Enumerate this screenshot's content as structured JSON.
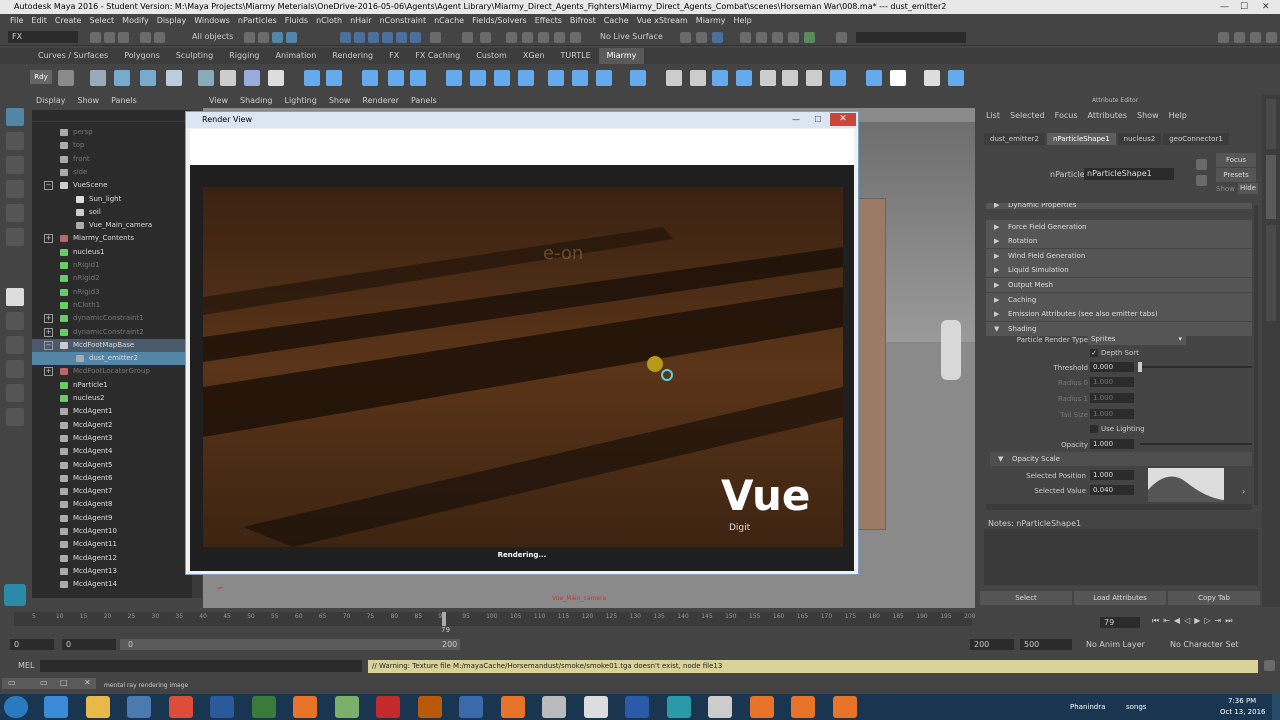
{
  "window": {
    "title": "Autodesk Maya 2016 - Student Version: M:\\Maya Projects\\Miarmy Meterials\\OneDrive-2016-05-06\\Agents\\Agent Library\\Miarmy_Direct_Agents_Fighters\\Miarmy_Direct_Agents_Combat\\scenes\\Horseman War\\008.ma*   ---   dust_emitter2"
  },
  "menubar": [
    "File",
    "Edit",
    "Create",
    "Select",
    "Modify",
    "Display",
    "Windows",
    "nParticles",
    "Fluids",
    "nCloth",
    "nHair",
    "nConstraint",
    "nCache",
    "Fields/Solvers",
    "Effects",
    "Bifrost",
    "Cache",
    "Vue xStream",
    "Miarmy",
    "Help"
  ],
  "statusline": {
    "mode": "FX",
    "selection_mask": "All objects",
    "live_surface": "No Live Surface"
  },
  "shelf_tabs": [
    "Curves / Surfaces",
    "Polygons",
    "Sculpting",
    "Rigging",
    "Animation",
    "Rendering",
    "FX",
    "FX Caching",
    "Custom",
    "XGen",
    "TURTLE",
    "Miarmy"
  ],
  "shelf_active": "Miarmy",
  "outliner": {
    "menu": [
      "Display",
      "Show",
      "Panels"
    ],
    "items": [
      {
        "label": "persp",
        "dim": true,
        "indent": 1,
        "icon": "camera-icon"
      },
      {
        "label": "top",
        "dim": true,
        "indent": 1,
        "icon": "camera-icon"
      },
      {
        "label": "front",
        "dim": true,
        "indent": 1,
        "icon": "camera-icon"
      },
      {
        "label": "side",
        "dim": true,
        "indent": 1,
        "icon": "camera-icon"
      },
      {
        "label": "VueScene",
        "dim": false,
        "indent": 1,
        "icon": "group-icon",
        "expander": "−"
      },
      {
        "label": "Sun_light",
        "dim": false,
        "indent": 2,
        "icon": "light-icon"
      },
      {
        "label": "soil",
        "dim": false,
        "indent": 2,
        "icon": "transform-icon"
      },
      {
        "label": "Vue_Main_camera",
        "dim": false,
        "indent": 2,
        "icon": "camera-icon"
      },
      {
        "label": "Miarmy_Contents",
        "dim": false,
        "indent": 1,
        "icon": "miarmy-icon",
        "expander": "+"
      },
      {
        "label": "nucleus1",
        "dim": false,
        "indent": 1,
        "icon": "nucleus-icon"
      },
      {
        "label": "nRigid1",
        "dim": true,
        "indent": 1,
        "icon": "nrigid-icon"
      },
      {
        "label": "nRigid2",
        "dim": true,
        "indent": 1,
        "icon": "nrigid-icon"
      },
      {
        "label": "nRigid3",
        "dim": true,
        "indent": 1,
        "icon": "nrigid-icon"
      },
      {
        "label": "nCloth1",
        "dim": true,
        "indent": 1,
        "icon": "ncloth-icon"
      },
      {
        "label": "dynamicConstraint1",
        "dim": true,
        "indent": 1,
        "icon": "constraint-icon",
        "expander": "+"
      },
      {
        "label": "dynamicConstraint2",
        "dim": true,
        "indent": 1,
        "icon": "constraint-icon",
        "expander": "+"
      },
      {
        "label": "McdFootMapBase",
        "dim": false,
        "indent": 1,
        "icon": "group-icon",
        "expander": "−",
        "highlight": true
      },
      {
        "label": "dust_emitter2",
        "dim": false,
        "indent": 2,
        "icon": "emitter-icon",
        "selected": true
      },
      {
        "label": "McdFootLocatorGroup",
        "dim": true,
        "indent": 1,
        "icon": "miarmy-icon",
        "expander": "+"
      },
      {
        "label": "nParticle1",
        "dim": false,
        "indent": 1,
        "icon": "nparticle-icon"
      },
      {
        "label": "nucleus2",
        "dim": false,
        "indent": 1,
        "icon": "nucleus-icon"
      },
      {
        "label": "McdAgent1",
        "dim": false,
        "indent": 1,
        "icon": "agent-icon"
      },
      {
        "label": "McdAgent2",
        "dim": false,
        "indent": 1,
        "icon": "agent-icon"
      },
      {
        "label": "McdAgent3",
        "dim": false,
        "indent": 1,
        "icon": "agent-icon"
      },
      {
        "label": "McdAgent4",
        "dim": false,
        "indent": 1,
        "icon": "agent-icon"
      },
      {
        "label": "McdAgent5",
        "dim": false,
        "indent": 1,
        "icon": "agent-icon"
      },
      {
        "label": "McdAgent6",
        "dim": false,
        "indent": 1,
        "icon": "agent-icon"
      },
      {
        "label": "McdAgent7",
        "dim": false,
        "indent": 1,
        "icon": "agent-icon"
      },
      {
        "label": "McdAgent8",
        "dim": false,
        "indent": 1,
        "icon": "agent-icon"
      },
      {
        "label": "McdAgent9",
        "dim": false,
        "indent": 1,
        "icon": "agent-icon"
      },
      {
        "label": "McdAgent10",
        "dim": false,
        "indent": 1,
        "icon": "agent-icon"
      },
      {
        "label": "McdAgent11",
        "dim": false,
        "indent": 1,
        "icon": "agent-icon"
      },
      {
        "label": "McdAgent12",
        "dim": false,
        "indent": 1,
        "icon": "agent-icon"
      },
      {
        "label": "McdAgent13",
        "dim": false,
        "indent": 1,
        "icon": "agent-icon"
      },
      {
        "label": "McdAgent14",
        "dim": false,
        "indent": 1,
        "icon": "agent-icon"
      }
    ]
  },
  "viewport": {
    "menu": [
      "View",
      "Shading",
      "Lighting",
      "Show",
      "Renderer",
      "Panels"
    ],
    "camera_label": "Vue_Main_camera"
  },
  "render_view": {
    "title": "Render View",
    "status": "Rendering...",
    "watermark_logo": "e-on",
    "brand_logo": "Vue",
    "brand_sub": "Digit"
  },
  "attribute_editor": {
    "header": "Attribute Editor",
    "menu": [
      "List",
      "Selected",
      "Focus",
      "Attributes",
      "Show",
      "Help"
    ],
    "tabs": [
      "dust_emitter2",
      "nParticleShape1",
      "nucleus2",
      "geoConnector1"
    ],
    "active_tab": "nParticleShape1",
    "node_label": "nParticle:",
    "node_value": "nParticleShape1",
    "focus_btn": "Focus",
    "presets_btn": "Presets",
    "show_label": "Show",
    "hide_btn": "Hide",
    "sections": [
      "Dynamic Properties",
      "Force Field Generation",
      "Rotation",
      "Wind Field Generation",
      "Liquid Simulation",
      "Output Mesh",
      "Caching",
      "Emission Attributes (see also emitter tabs)",
      "Shading"
    ],
    "shading": {
      "render_type_label": "Particle Render Type",
      "render_type_value": "Sprites",
      "depth_sort_label": "Depth Sort",
      "depth_sort": true,
      "threshold_label": "Threshold",
      "threshold_value": "0.000",
      "radius0_label": "Radius 0",
      "radius0_value": "1.000",
      "radius1_label": "Radius 1",
      "radius1_value": "1.000",
      "tailsize_label": "Tail Size",
      "tailsize_value": "1.000",
      "use_lighting_label": "Use Lighting",
      "opacity_label": "Opacity",
      "opacity_value": "1.000"
    },
    "opacity_scale": {
      "title": "Opacity Scale",
      "sel_pos_label": "Selected Position",
      "sel_pos_value": "1.000",
      "sel_val_label": "Selected Value",
      "sel_val_value": "0.040"
    },
    "notes_label": "Notes:  nParticleShape1",
    "bottom_buttons": [
      "Select",
      "Load Attributes",
      "Copy Tab"
    ],
    "side_tabs": [
      "Tool Settings",
      "Attribute Editor",
      "Channel Box / Layer Editor"
    ]
  },
  "timeline": {
    "ticks": [
      "5",
      "10",
      "15",
      "20",
      "25",
      "30",
      "35",
      "40",
      "45",
      "50",
      "55",
      "60",
      "65",
      "70",
      "75",
      "80",
      "85",
      "90",
      "95",
      "100",
      "105",
      "110",
      "115",
      "120",
      "125",
      "130",
      "135",
      "140",
      "145",
      "150",
      "155",
      "160",
      "165",
      "170",
      "175",
      "180",
      "185",
      "190",
      "195",
      "200"
    ],
    "current_frame": "79",
    "current_field": "79"
  },
  "range": {
    "start": "0",
    "start2": "0",
    "slider_start": "0",
    "slider_end": "200",
    "end": "200",
    "end2": "500",
    "anim_layer": "No Anim Layer",
    "char_set": "No Character Set"
  },
  "command": {
    "lang": "MEL",
    "warning": "// Warning: Texture file M:/mayaCache/Horsemandust/smoke/smoke01.tga doesn't exist, node file13"
  },
  "help_line": "mental ray rendering image",
  "taskbar": {
    "user": "Phanindra",
    "folder": "songs",
    "time": "7:36 PM",
    "date": "Oct 13, 2016",
    "apps": [
      "ie-icon",
      "explorer-icon",
      "media-player-icon",
      "chrome-icon",
      "photoshop-icon",
      "dreamweaver-icon",
      "firefox-icon",
      "notepad-icon",
      "filezilla-icon",
      "illustrator-icon",
      "settings-icon",
      "vlc-icon",
      "file-icon",
      "folder-icon",
      "word-icon",
      "maya-icon",
      "tools-icon",
      "app1-icon",
      "app2-icon",
      "app3-icon"
    ]
  },
  "colors": {
    "maya_bg": "#444444",
    "panel_dark": "#2b2b2b",
    "selected_row": "#5285a6",
    "warning_bg": "#d9d39a",
    "taskbar": "#1a3550"
  }
}
